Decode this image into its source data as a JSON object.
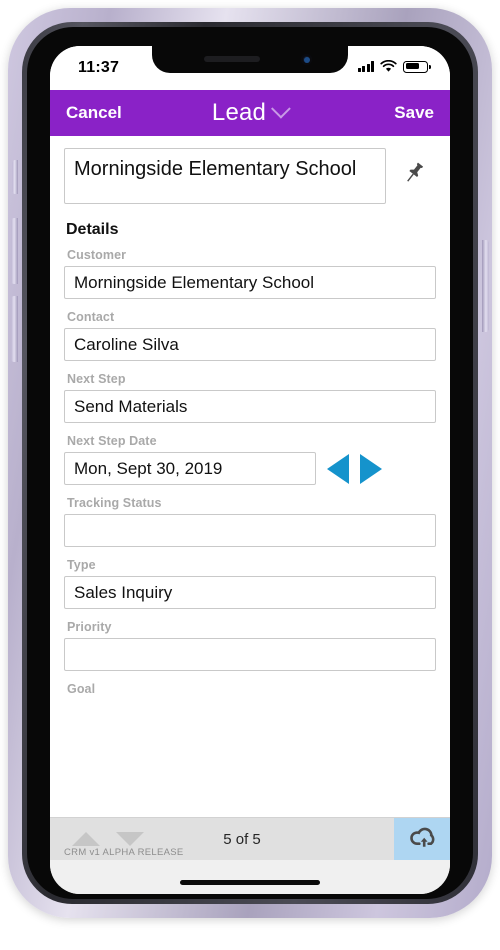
{
  "status_bar": {
    "time": "11:37",
    "signal_icon": "cellular-signal-icon",
    "wifi_icon": "wifi-icon",
    "battery_icon": "battery-icon"
  },
  "navbar": {
    "cancel_label": "Cancel",
    "title": "Lead",
    "title_chevron_icon": "chevron-down-icon",
    "save_label": "Save",
    "background_color": "#8a22c7"
  },
  "record": {
    "title": "Morningside Elementary School",
    "pin_icon": "pushpin-icon"
  },
  "details": {
    "heading": "Details",
    "fields": [
      {
        "label": "Customer",
        "value": "Morningside Elementary School",
        "has_stepper": false
      },
      {
        "label": "Contact",
        "value": "Caroline Silva",
        "has_stepper": false
      },
      {
        "label": "Next Step",
        "value": "Send Materials",
        "has_stepper": false
      },
      {
        "label": "Next Step Date",
        "value": "Mon, Sept 30, 2019",
        "has_stepper": true
      },
      {
        "label": "Tracking Status",
        "value": "",
        "has_stepper": false
      },
      {
        "label": "Type",
        "value": "Sales Inquiry",
        "has_stepper": false
      },
      {
        "label": "Priority",
        "value": "",
        "has_stepper": false
      }
    ],
    "partial_field_label": "Goal"
  },
  "date_stepper": {
    "prev_icon": "triangle-left-icon",
    "next_icon": "triangle-right-icon",
    "color": "#1593cc"
  },
  "bottom_bar": {
    "prev_record_icon": "triangle-up-icon",
    "next_record_icon": "triangle-down-icon",
    "counter": "5 of 5",
    "sync_icon": "cloud-upload-icon",
    "sync_background_color": "#aed6f2"
  },
  "footer": {
    "release_note": "CRM v1 ALPHA RELEASE"
  }
}
